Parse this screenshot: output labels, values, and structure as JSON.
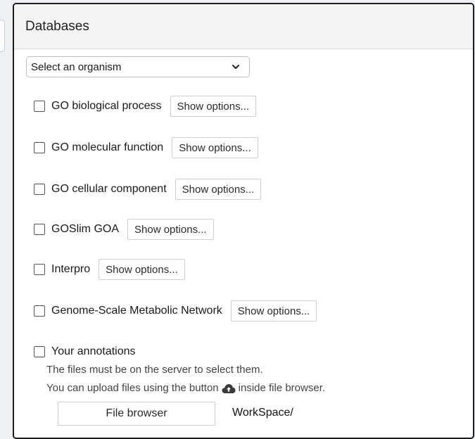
{
  "panel": {
    "title": "Databases"
  },
  "organism_select": {
    "selected": "Select an organism",
    "icon": "chevron-down-icon"
  },
  "databases": [
    {
      "label": "GO biological process",
      "checked": false,
      "options_label": "Show options..."
    },
    {
      "label": "GO molecular function",
      "checked": false,
      "options_label": "Show options..."
    },
    {
      "label": "GO cellular component",
      "checked": false,
      "options_label": "Show options..."
    },
    {
      "label": "GOSlim GOA",
      "checked": false,
      "options_label": "Show options..."
    },
    {
      "label": "Interpro",
      "checked": false,
      "options_label": "Show options..."
    },
    {
      "label": "Genome-Scale Metabolic Network",
      "checked": false,
      "options_label": "Show options..."
    }
  ],
  "annotations": {
    "label": "Your annotations",
    "checked": false,
    "note_line1": "The files must be on the server to select them.",
    "note_line2_before": "You can upload files using the button",
    "note_line2_icon": "cloud-upload-icon",
    "note_line2_after": "inside file browser.",
    "file_browser_label": "File browser",
    "path": "WorkSpace/"
  }
}
